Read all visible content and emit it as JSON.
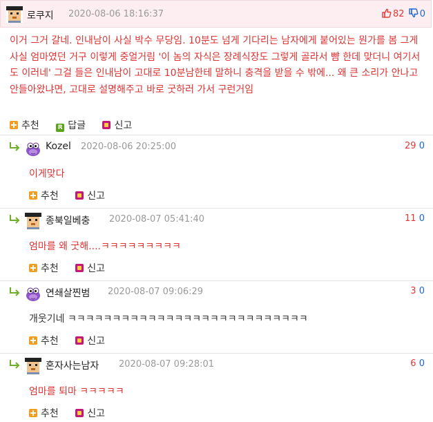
{
  "main": {
    "nickname": "로쿠지",
    "date": "2020-08-06 18:16:37",
    "upvotes": "82",
    "downvotes": "0",
    "body": "이거 그거 갈네. 인내남이 사실 박수 무당임. 10분도 넘게 기다리는 남자에게 붙어있는 뭔가를 봄 그게 사실 엄마였던 거구 이렇게 중얼거림 '이 놈의 자식은 장례식장도 그렇게 골라서 뺨 한데 맞더니 여기서도 이러네' 그걸 들은 인내남이 고대로 10분남한테 말하니 충격을 받을 수 밖에... 왜 큰 소리가 안나고 안들아왔냐면, 고대로 설명해주고 바로 굿하러 가서 구런거임",
    "actions": {
      "recommend": "추천",
      "reply": "답글",
      "report": "신고"
    }
  },
  "replies": [
    {
      "nickname": "Kozel",
      "date": "2020-08-06 20:25:00",
      "upvotes": "29",
      "downvotes": "0",
      "text": "이게맞다",
      "avatar": "purple-monster"
    },
    {
      "nickname": "종북일베충",
      "date": "2020-08-07 05:41:40",
      "upvotes": "11",
      "downvotes": "0",
      "text": "엄마를 왜 굿해....ㅋㅋㅋㅋㅋㅋㅋㅋㅋ",
      "avatar": "pixel-face"
    },
    {
      "nickname": "연쇄살찐범",
      "date": "2020-08-07 09:06:29",
      "upvotes": "3",
      "downvotes": "0",
      "text": "개웃기네 ㅋㅋㅋㅋㅋㅋㅋㅋㅋㅋㅋㅋㅋㅋㅋㅋㅋㅋㅋㅋㅋㅋㅋㅋㅋㅋㅋ",
      "avatar": "purple-monster"
    },
    {
      "nickname": "혼자사는남자",
      "date": "2020-08-07 09:28:01",
      "upvotes": "6",
      "downvotes": "0",
      "text": "엄마를 퇴마 ㅋㅋㅋㅋㅋ",
      "avatar": "pixel-face"
    }
  ],
  "reply_actions": {
    "recommend": "추천",
    "report": "신고"
  },
  "colors": {
    "header_bg": "#fdeff1",
    "comment_text": "#dd3333",
    "upvote": "#e53935",
    "downvote": "#1e63d3"
  }
}
